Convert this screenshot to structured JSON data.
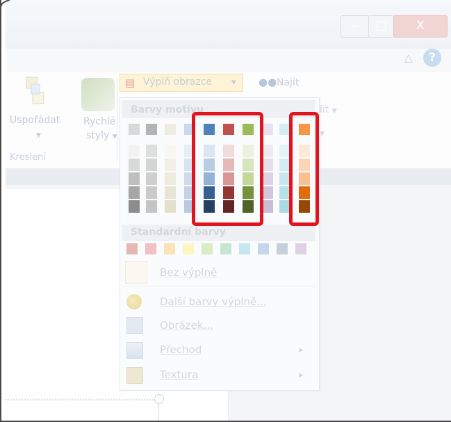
{
  "window": {
    "minimize_glyph": "–",
    "maximize_glyph": "□",
    "close_glyph": "X",
    "help_glyph": "?",
    "collapse_glyph": "△"
  },
  "ribbon": {
    "arrange_label": "Uspořádat",
    "quick_styles_label_1": "Rychlé",
    "quick_styles_label_2": "styly",
    "group_label": "Kreslení",
    "fill_button_label": "Výplň obrazce",
    "find_label": "Najít",
    "edit_label": "dit",
    "dropdown_caret": "▼"
  },
  "fill_menu": {
    "theme_colors_title": "Barvy motivu",
    "theme_top_row": [
      "#d9d9d9",
      "#b3b3b3",
      "#eeece1",
      "#c6d9f0",
      "#4f81bd",
      "#c0504d",
      "#9bbb59",
      "#e8e2f0",
      "#d2eef4",
      "#f79646"
    ],
    "theme_columns": [
      {
        "tints": [
          "#f2f2f2",
          "#d9d9d9",
          "#bfbfbf",
          "#a6a6a6",
          "#8c8c8c"
        ]
      },
      {
        "tints": [
          "#dedede",
          "#d4d4d4",
          "#cfcfcf",
          "#cacaca",
          "#c4c4c4"
        ]
      },
      {
        "tints": [
          "#f7f6f0",
          "#f2f0e6",
          "#edebdd",
          "#e8e5d4",
          "#e3e0cb"
        ]
      },
      {
        "tints": [
          "#e6ecf5",
          "#dbe3f0",
          "#d0daeb",
          "#c5d1e6",
          "#bac8e1"
        ]
      },
      {
        "tints": [
          "#dce6f2",
          "#b8cce4",
          "#95b3d7",
          "#366092",
          "#244062"
        ]
      },
      {
        "tints": [
          "#f2dcdb",
          "#e6b9b8",
          "#da9694",
          "#963634",
          "#632523"
        ]
      },
      {
        "tints": [
          "#ebf1de",
          "#d8e4bc",
          "#c4d79b",
          "#76933c",
          "#4f6228"
        ]
      },
      {
        "tints": [
          "#efebf3",
          "#e5dfec",
          "#dcd3e5",
          "#d2c8de",
          "#c8bcd7"
        ]
      },
      {
        "tints": [
          "#e3f3f7",
          "#d4edf2",
          "#c6e7ee",
          "#b7e1e9",
          "#a9dbe4"
        ]
      },
      {
        "tints": [
          "#fde9d9",
          "#fcd5b4",
          "#fabf8f",
          "#e26b0a",
          "#974706"
        ]
      }
    ],
    "standard_colors_title": "Standardní barvy",
    "standard_colors": [
      "#e8b5b5",
      "#f1c0c0",
      "#fbe2b8",
      "#fcf6c0",
      "#d9ecc6",
      "#c6e6d3",
      "#c6e6f0",
      "#c4d6ec",
      "#c8cedb",
      "#ddd1e6"
    ],
    "no_fill_label": "Bez výplně",
    "more_colors_label": "Další barvy výplně...",
    "picture_label": "Obrázek...",
    "gradient_label": "Přechod",
    "texture_label": "Textura",
    "submenu_arrow": "▶"
  },
  "callout_color": "#e0141e"
}
